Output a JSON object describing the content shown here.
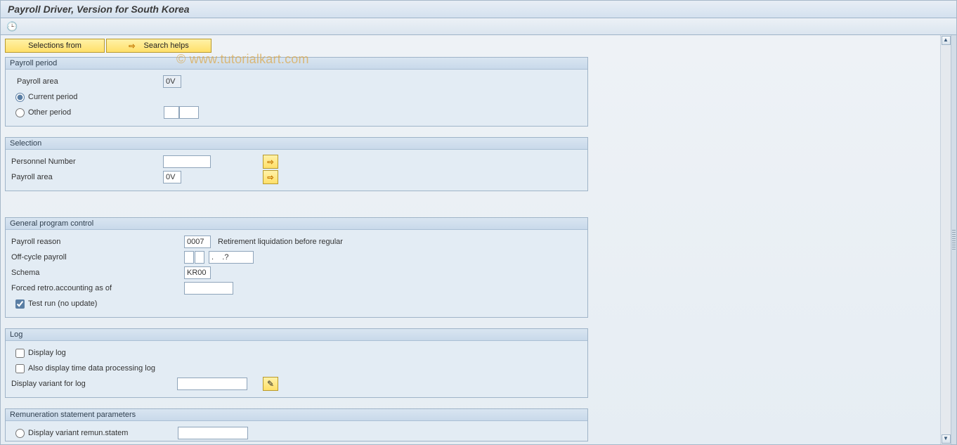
{
  "title": "Payroll Driver, Version for South Korea",
  "watermark": "© www.tutorialkart.com",
  "toolbar": {
    "selections_from": "Selections from",
    "search_helps": "Search helps"
  },
  "groups": {
    "payroll_period": {
      "legend": "Payroll period",
      "payroll_area_label": "Payroll area",
      "payroll_area_value": "0V",
      "current_period": "Current period",
      "other_period": "Other period",
      "other_period_val1": "",
      "other_period_val2": ""
    },
    "selection": {
      "legend": "Selection",
      "personnel_number_label": "Personnel Number",
      "personnel_number_value": "",
      "payroll_area_label": "Payroll area",
      "payroll_area_value": "0V"
    },
    "general": {
      "legend": "General program control",
      "payroll_reason_label": "Payroll reason",
      "payroll_reason_value": "0007",
      "payroll_reason_desc": "Retirement liquidation before regular",
      "offcycle_label": "Off-cycle payroll",
      "offcycle_val1": "",
      "offcycle_val2": "",
      "offcycle_date": ".    .?",
      "schema_label": "Schema",
      "schema_value": "KR00",
      "forced_retro_label": "Forced retro.accounting as of",
      "forced_retro_value": "",
      "test_run": "Test run (no update)"
    },
    "log": {
      "legend": "Log",
      "display_log": "Display log",
      "also_time_log": "Also display time data processing log",
      "variant_label": "Display variant for log",
      "variant_value": ""
    },
    "remun": {
      "legend": "Remuneration statement parameters",
      "display_variant": "Display variant remun.statem",
      "display_variant_value": ""
    }
  }
}
